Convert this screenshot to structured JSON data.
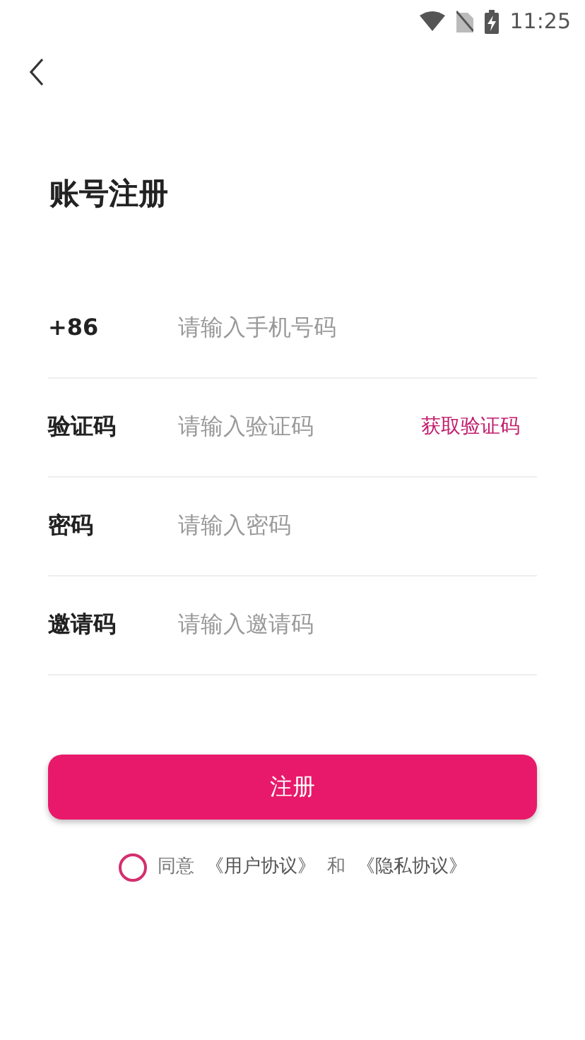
{
  "status_bar": {
    "time": "11:25"
  },
  "title": "账号注册",
  "fields": [
    {
      "kind": "text",
      "label": "+86",
      "placeholder": "请输入手机号码"
    },
    {
      "kind": "code",
      "label": "验证码",
      "placeholder": "请输入验证码",
      "action": "获取验证码"
    },
    {
      "kind": "text",
      "label": "密码",
      "placeholder": "请输入密码"
    },
    {
      "kind": "text",
      "label": "邀请码",
      "placeholder": "请输入邀请码"
    }
  ],
  "submit": "注册",
  "agreement": {
    "checked": false,
    "parts": [
      {
        "kind": "text",
        "text": "同意"
      },
      {
        "kind": "link",
        "text": "《用户协议》"
      },
      {
        "kind": "text",
        "text": "和"
      },
      {
        "kind": "link",
        "text": "《隐私协议》"
      }
    ]
  }
}
